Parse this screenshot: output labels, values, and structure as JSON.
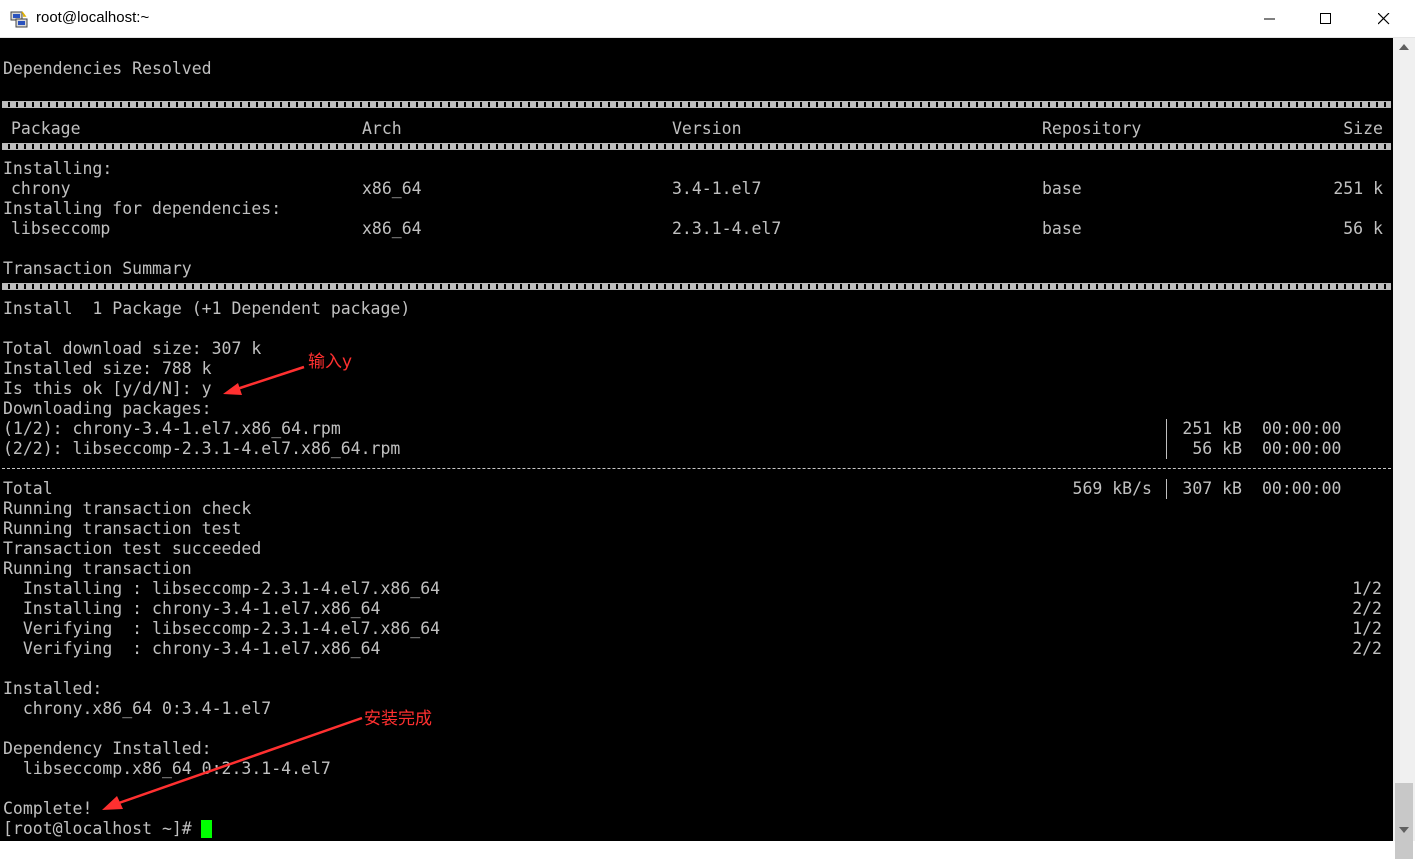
{
  "window": {
    "title": "root@localhost:~"
  },
  "terminal": {
    "deps_resolved": "Dependencies Resolved",
    "headers": {
      "package": "Package",
      "arch": "Arch",
      "version": "Version",
      "repository": "Repository",
      "size": "Size"
    },
    "installing_label": "Installing:",
    "installing_deps_label": "Installing for dependencies:",
    "rows": [
      {
        "package": "chrony",
        "arch": "x86_64",
        "version": "3.4-1.el7",
        "repository": "base",
        "size": "251 k"
      },
      {
        "package": "libseccomp",
        "arch": "x86_64",
        "version": "2.3.1-4.el7",
        "repository": "base",
        "size": "56 k"
      }
    ],
    "transaction_summary": "Transaction Summary",
    "install_summary": "Install  1 Package (+1 Dependent package)",
    "total_download": "Total download size: 307 k",
    "installed_size": "Installed size: 788 k",
    "prompt_question": "Is this ok [y/d/N]: y",
    "downloading": "Downloading packages:",
    "downloads": [
      {
        "name": "(1/2): chrony-3.4-1.el7.x86_64.rpm",
        "size": "251 kB",
        "time": "00:00:00"
      },
      {
        "name": "(2/2): libseccomp-2.3.1-4.el7.x86_64.rpm",
        "size": "56 kB",
        "time": "00:00:00"
      }
    ],
    "total": {
      "label": "Total",
      "speed": "569 kB/s",
      "size": "307 kB",
      "time": "00:00:00"
    },
    "running_check": "Running transaction check",
    "running_test": "Running transaction test",
    "test_succeeded": "Transaction test succeeded",
    "running_transaction": "Running transaction",
    "steps": [
      {
        "text": "  Installing : libseccomp-2.3.1-4.el7.x86_64",
        "count": "1/2"
      },
      {
        "text": "  Installing : chrony-3.4-1.el7.x86_64",
        "count": "2/2"
      },
      {
        "text": "  Verifying  : libseccomp-2.3.1-4.el7.x86_64",
        "count": "1/2"
      },
      {
        "text": "  Verifying  : chrony-3.4-1.el7.x86_64",
        "count": "2/2"
      }
    ],
    "installed_label": "Installed:",
    "installed_pkg": "  chrony.x86_64 0:3.4-1.el7",
    "dep_installed_label": "Dependency Installed:",
    "dep_installed_pkg": "  libseccomp.x86_64 0:2.3.1-4.el7",
    "complete": "Complete!",
    "prompt": "[root@localhost ~]# "
  },
  "annotations": {
    "input_y": "输入y",
    "install_complete": "安装完成",
    "color": "#ff3030"
  },
  "colors": {
    "terminal_bg": "#000000",
    "terminal_fg": "#c0c0c0",
    "cursor": "#00ff00"
  }
}
